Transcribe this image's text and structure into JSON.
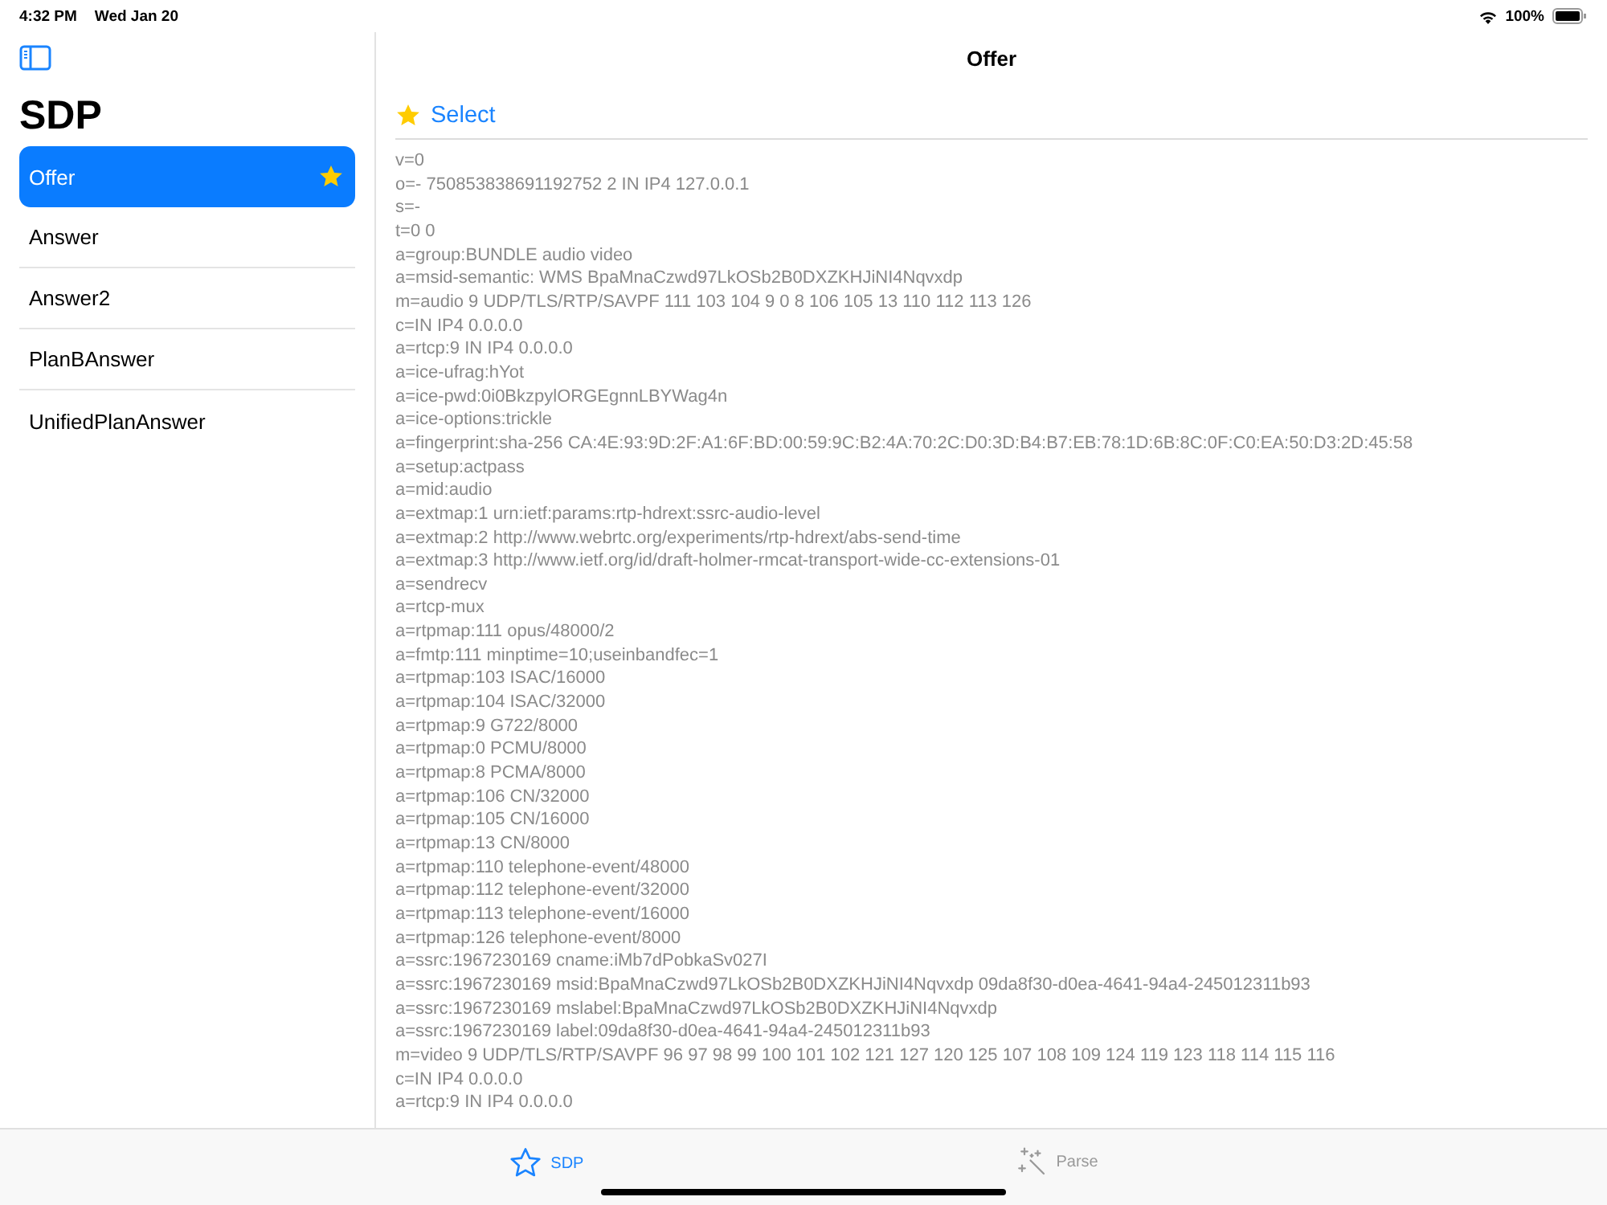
{
  "status_bar": {
    "time": "4:32 PM",
    "date": "Wed Jan 20",
    "battery": "100%"
  },
  "sidebar": {
    "title": "SDP",
    "items": [
      {
        "label": "Offer",
        "selected": true,
        "favorite": true
      },
      {
        "label": "Answer",
        "selected": false,
        "favorite": false
      },
      {
        "label": "Answer2",
        "selected": false,
        "favorite": false
      },
      {
        "label": "PlanBAnswer",
        "selected": false,
        "favorite": false
      },
      {
        "label": "UnifiedPlanAnswer",
        "selected": false,
        "favorite": false
      }
    ]
  },
  "detail": {
    "title": "Offer",
    "select_button": "Select",
    "lines": [
      "v=0",
      "o=- 750853838691192752 2 IN IP4 127.0.0.1",
      "s=-",
      "t=0 0",
      "a=group:BUNDLE audio video",
      "a=msid-semantic: WMS BpaMnaCzwd97LkOSb2B0DXZKHJiNI4Nqvxdp",
      "m=audio 9 UDP/TLS/RTP/SAVPF 111 103 104 9 0 8 106 105 13 110 112 113 126",
      "c=IN IP4 0.0.0.0",
      "a=rtcp:9 IN IP4 0.0.0.0",
      "a=ice-ufrag:hYot",
      "a=ice-pwd:0i0BkzpylORGEgnnLBYWag4n",
      "a=ice-options:trickle",
      "a=fingerprint:sha-256 CA:4E:93:9D:2F:A1:6F:BD:00:59:9C:B2:4A:70:2C:D0:3D:B4:B7:EB:78:1D:6B:8C:0F:C0:EA:50:D3:2D:45:58",
      "a=setup:actpass",
      "a=mid:audio",
      "a=extmap:1 urn:ietf:params:rtp-hdrext:ssrc-audio-level",
      "a=extmap:2 http://www.webrtc.org/experiments/rtp-hdrext/abs-send-time",
      "a=extmap:3 http://www.ietf.org/id/draft-holmer-rmcat-transport-wide-cc-extensions-01",
      "a=sendrecv",
      "a=rtcp-mux",
      "a=rtpmap:111 opus/48000/2",
      "a=fmtp:111 minptime=10;useinbandfec=1",
      "a=rtpmap:103 ISAC/16000",
      "a=rtpmap:104 ISAC/32000",
      "a=rtpmap:9 G722/8000",
      "a=rtpmap:0 PCMU/8000",
      "a=rtpmap:8 PCMA/8000",
      "a=rtpmap:106 CN/32000",
      "a=rtpmap:105 CN/16000",
      "a=rtpmap:13 CN/8000",
      "a=rtpmap:110 telephone-event/48000",
      "a=rtpmap:112 telephone-event/32000",
      "a=rtpmap:113 telephone-event/16000",
      "a=rtpmap:126 telephone-event/8000",
      "a=ssrc:1967230169 cname:iMb7dPobkaSv027I",
      "a=ssrc:1967230169 msid:BpaMnaCzwd97LkOSb2B0DXZKHJiNI4Nqvxdp 09da8f30-d0ea-4641-94a4-245012311b93",
      "a=ssrc:1967230169 mslabel:BpaMnaCzwd97LkOSb2B0DXZKHJiNI4Nqvxdp",
      "a=ssrc:1967230169 label:09da8f30-d0ea-4641-94a4-245012311b93",
      "m=video 9 UDP/TLS/RTP/SAVPF 96 97 98 99 100 101 102 121 127 120 125 107 108 109 124 119 123 118 114 115 116",
      "c=IN IP4 0.0.0.0",
      "a=rtcp:9 IN IP4 0.0.0.0"
    ]
  },
  "tab_bar": [
    {
      "label": "SDP",
      "kind": "star",
      "selected": true
    },
    {
      "label": "Parse",
      "kind": "wand",
      "selected": false
    }
  ]
}
